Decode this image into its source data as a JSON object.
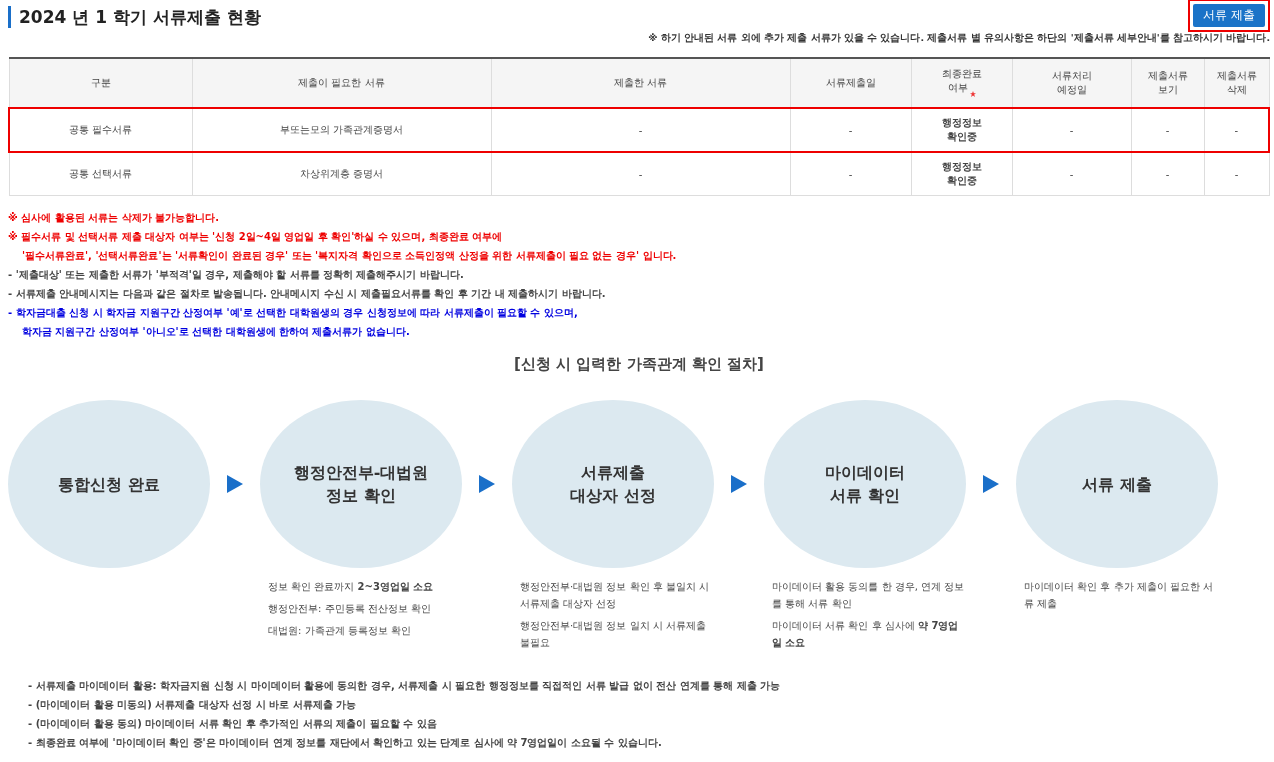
{
  "header": {
    "title": "2024 년 1 학기 서류제출 현황",
    "submit_button": {
      "label": "서류 제출",
      "highlighted": true
    },
    "notice": "※ 하기 안내된 서류 외에 추가 제출 서류가 있을 수 있습니다. 제출서류 별 유의사항은 하단의 '제출서류 세부안내'를 참고하시기 바랍니다."
  },
  "table": {
    "columns": [
      {
        "label": "구분",
        "required": false
      },
      {
        "label": "제출이 필요한 서류",
        "required": false
      },
      {
        "label": "제출한 서류",
        "required": false
      },
      {
        "label": "서류제출일",
        "required": false
      },
      {
        "label": "최종완료\n여부",
        "required": true
      },
      {
        "label": "서류처리\n예정일",
        "required": false
      },
      {
        "label": "제출서류\n보기",
        "required": false
      },
      {
        "label": "제출서류\n삭제",
        "required": false
      }
    ],
    "rows": [
      {
        "highlighted": true,
        "cells": [
          "공통 필수서류",
          "부또는모의 가족관계증명서",
          "-",
          "-",
          "행정정보\n확인중",
          "-",
          "-",
          "-"
        ]
      },
      {
        "highlighted": false,
        "cells": [
          "공통 선택서류",
          "차상위계층 증명서",
          "-",
          "-",
          "행정정보\n확인중",
          "-",
          "-",
          "-"
        ]
      }
    ]
  },
  "notes": [
    {
      "kind": "warning",
      "lines": [
        "※ 심사에 활용된 서류는 삭제가 불가능합니다."
      ]
    },
    {
      "kind": "warning",
      "lines": [
        "※ 필수서류 및 선택서류 제출 대상자 여부는 '신청 2일~4일 영업일 후 확인'하실 수 있으며, 최종완료 여부에",
        "'필수서류완료', '선택서류완료'는 '서류확인이 완료된 경우' 또는 '복지자격 확인으로 소득인정액 산정을 위한 서류제출이 필요 없는 경우' 입니다."
      ]
    },
    {
      "kind": "normal",
      "lines": [
        "- '제출대상' 또는 제출한 서류가 '부적격'일 경우, 제출해야 할 서류를 정확히 제출해주시기 바랍니다."
      ]
    },
    {
      "kind": "normal",
      "lines": [
        "- 서류제출 안내메시지는 다음과 같은 절차로 발송됩니다. 안내메시지 수신 시 제출필요서류를 확인 후 기간 내 제출하시기 바랍니다."
      ]
    },
    {
      "kind": "info",
      "lines": [
        "- 학자금대출 신청 시 학자금 지원구간 산정여부 '예'로 선택한 대학원생의 경우 신청정보에 따라 서류제출이 필요할 수 있으며,",
        "학자금 지원구간 산정여부 '아니오'로 선택한 대학원생에 한하여 제출서류가 없습니다."
      ]
    }
  ],
  "process": {
    "title": "[신청 시 입력한 가족관계 확인 절차]",
    "steps": [
      {
        "label": "통합신청 완료"
      },
      {
        "label": "행정안전부-대법원\n정보 확인",
        "details": [
          "정보 확인 완료까지 **2~3영업일 소요**",
          "행정안전부: 주민등록 전산정보 확인",
          "대법원: 가족관계 등록정보 확인"
        ]
      },
      {
        "label": "서류제출\n대상자 선정",
        "details": [
          "행정안전부·대법원 정보 확인 후 불일치 시 서류제출 대상자 선정",
          "행정안전부·대법원 정보 일치 시 서류제출 불필요"
        ]
      },
      {
        "label": "마이데이터\n서류 확인",
        "details": [
          "마이데이터 활용 동의를 한 경우, 연계 정보를 통해 서류 확인",
          "마이데이터 서류 확인 후 심사에 **약 7영업일 소요**"
        ]
      },
      {
        "label": "서류 제출",
        "details": [
          "마이데이터 확인 후 추가 제출이 필요한 서류 제출"
        ]
      }
    ]
  },
  "footer_notes": [
    "- 서류제출 마이데이터 활용: 학자금지원 신청 시 마이데이터 활용에 동의한 경우, 서류제출 시 필요한 행정정보를 직접적인 서류 발급 없이 전산 연계를 통해 제출 가능",
    "- (마이데이터 활용 미동의) 서류제출 대상자 선정 시 바로 서류제출 가능",
    "- (마이데이터 활용 동의) 마이데이터 서류 확인 후 추가적인 서류의 제출이 필요할 수 있음",
    "- 최종완료 여부에 '마이데이터 확인 중'은 마이데이터 연계 정보를 재단에서 확인하고 있는 단계로 심사에 약 7영업일이 소요될 수 있습니다."
  ]
}
